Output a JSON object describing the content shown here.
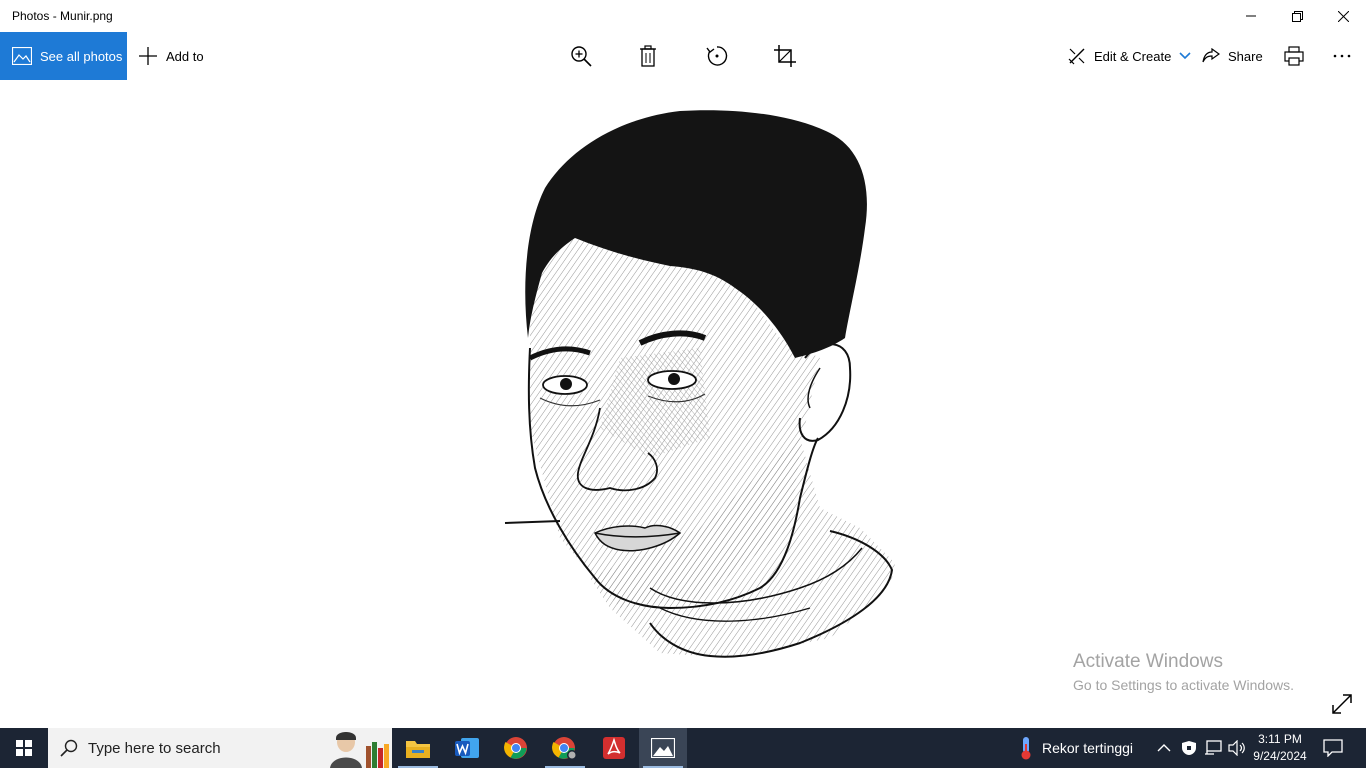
{
  "window": {
    "title": "Photos - Munir.png"
  },
  "toolbar": {
    "see_all_label": "See all photos",
    "add_to_label": "Add to",
    "edit_create_label": "Edit & Create",
    "share_label": "Share"
  },
  "watermark": {
    "line1": "Activate Windows",
    "line2": "Go to Settings to activate Windows."
  },
  "taskbar": {
    "search_placeholder": "Type here to search",
    "weather_text": "Rekor tertinggi",
    "time": "3:11 PM",
    "date": "9/24/2024",
    "apps": [
      "file-explorer",
      "word",
      "chrome",
      "chrome-profile",
      "acrobat",
      "photos"
    ]
  },
  "colors": {
    "accent": "#1e7ad6",
    "taskbar": "#1c2534"
  }
}
